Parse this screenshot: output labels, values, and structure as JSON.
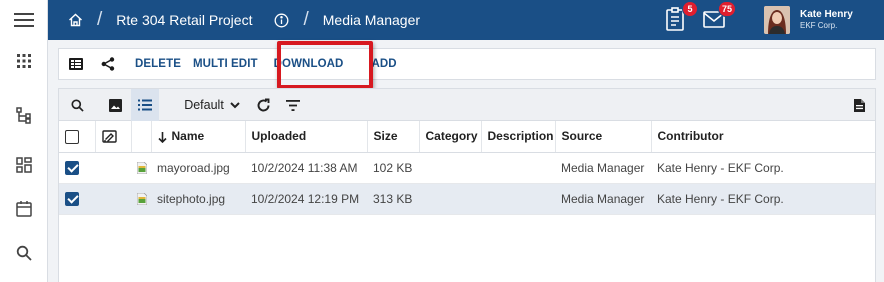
{
  "breadcrumb": {
    "project": "Rte 304 Retail Project",
    "page": "Media Manager",
    "separator": "/"
  },
  "notifications": {
    "tasks_count": "5",
    "messages_count": "75"
  },
  "user": {
    "name": "Kate Henry",
    "org": "EKF Corp."
  },
  "actions": {
    "delete": "DELETE",
    "multi_edit": "MULTI EDIT",
    "download": "DOWNLOAD",
    "add": "ADD"
  },
  "grid_toolbar": {
    "view": "Default"
  },
  "columns": {
    "name": "Name",
    "uploaded": "Uploaded",
    "size": "Size",
    "category": "Category",
    "description": "Description",
    "source": "Source",
    "contributor": "Contributor"
  },
  "rows": [
    {
      "checked": true,
      "name": "mayoroad.jpg",
      "uploaded": "10/2/2024 11:38 AM",
      "size": "102 KB",
      "category": "",
      "description": "",
      "source": "Media Manager",
      "contributor": "Kate Henry - EKF Corp."
    },
    {
      "checked": true,
      "name": "sitephoto.jpg",
      "uploaded": "10/2/2024 12:19 PM",
      "size": "313 KB",
      "category": "",
      "description": "",
      "source": "Media Manager",
      "contributor": "Kate Henry - EKF Corp."
    }
  ],
  "colors": {
    "topbar": "#1a4f86",
    "accent": "#1a4f86",
    "badge": "#e01e2e",
    "highlight_box": "#d71920",
    "selected_row": "#e6ebf2"
  },
  "icons": {
    "rail": [
      "hamburger-menu-icon",
      "apps-grid-icon",
      "hierarchy-icon",
      "dashboard-icon",
      "calendar-icon",
      "search-icon"
    ],
    "topbar": [
      "home-icon",
      "info-icon",
      "tasks-clipboard-icon",
      "mail-icon"
    ],
    "actionbar": [
      "list-view-icon",
      "share-icon"
    ],
    "grid_toolbar": [
      "search-icon",
      "image-view-icon",
      "list-view-icon",
      "chevron-down-icon",
      "refresh-icon",
      "filter-icon",
      "pdf-export-icon"
    ]
  }
}
